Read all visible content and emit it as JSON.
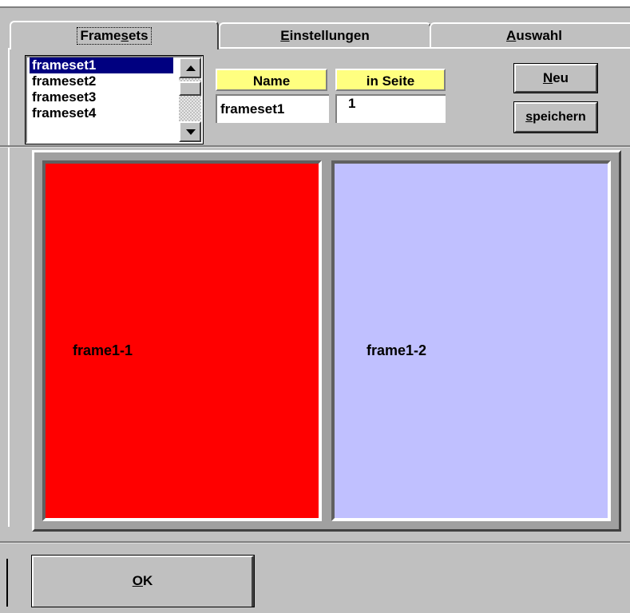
{
  "tabs": [
    {
      "label": "Framesets",
      "active": true
    },
    {
      "label": "Einstellungen",
      "active": false
    },
    {
      "label": "Auswahl",
      "active": false
    }
  ],
  "framesets_list": {
    "items": [
      "frameset1",
      "frameset2",
      "frameset3",
      "frameset4"
    ],
    "selected": "frameset1"
  },
  "form": {
    "name_header": "Name",
    "in_seite_header": "in Seite",
    "name_value": "frameset1",
    "in_seite_value": "1"
  },
  "buttons": {
    "neu": "Neu",
    "speichern": "speichern",
    "ok": "OK"
  },
  "frames": [
    {
      "label": "frame1-1",
      "color": "#ff0000"
    },
    {
      "label": "frame1-2",
      "color": "#c0c0ff"
    }
  ],
  "colors": {
    "header_bg": "#ffff80",
    "selection": "#000080",
    "window_bg": "#c0c0c0"
  }
}
